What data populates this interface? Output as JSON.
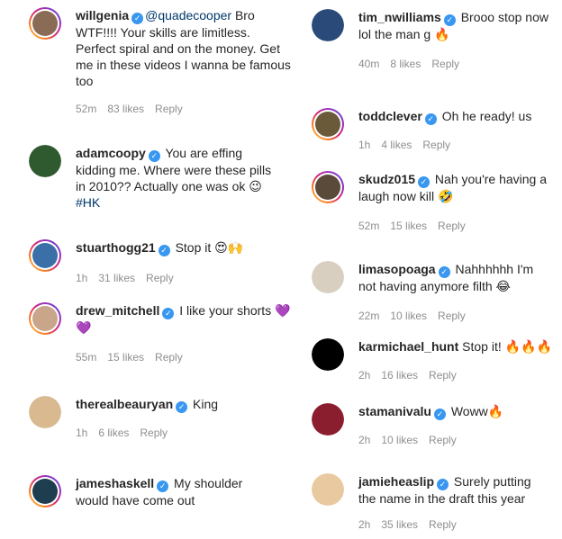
{
  "left": [
    {
      "user": "willgenia",
      "mention": "@quadecooper",
      "text": " Bro WTF!!!! Your skills are limitless. Perfect spiral and on the money. Get me in these videos I wanna be famous too",
      "time": "52m",
      "likes": "83 likes",
      "reply": "Reply",
      "avatar_color": "#8a6b55",
      "ring": true
    },
    {
      "user": "adamcoopy",
      "text": " You are effing kidding me. Where were these pills in 2010?? Actually one was ok 😉 ",
      "hashtag": "#HK",
      "time": "",
      "likes": "",
      "reply": "",
      "avatar_color": "#2f5a2f",
      "ring": false
    },
    {
      "user": "stuarthogg21",
      "text": " Stop it 😍🙌",
      "time": "1h",
      "likes": "31 likes",
      "reply": "Reply",
      "avatar_color": "#3b6fa8",
      "ring": true
    },
    {
      "user": "drew_mitchell",
      "text": " I like your shorts 💜💜",
      "time": "55m",
      "likes": "15 likes",
      "reply": "Reply",
      "avatar_color": "#c9a58a",
      "ring": true
    },
    {
      "user": "therealbeauryan",
      "text": " King",
      "time": "1h",
      "likes": "6 likes",
      "reply": "Reply",
      "avatar_color": "#d9b98f",
      "ring": false
    },
    {
      "user": "jameshaskell",
      "text": " My shoulder would have come out",
      "time": "",
      "likes": "",
      "reply": "",
      "avatar_color": "#1e3d4f",
      "ring": true
    }
  ],
  "right": [
    {
      "user": "tim_nwilliams",
      "text": " Brooo stop now lol the man g 🔥",
      "time": "40m",
      "likes": "8 likes",
      "reply": "Reply",
      "avatar_color": "#2a4a7a",
      "ring": false
    },
    {
      "user": "toddclever",
      "text": " Oh he ready! us",
      "time": "1h",
      "likes": "4 likes",
      "reply": "Reply",
      "avatar_color": "#6a5a3a",
      "ring": true
    },
    {
      "user": "skudz015",
      "text": " Nah you're having a laugh now kill 🤣",
      "time": "52m",
      "likes": "15 likes",
      "reply": "Reply",
      "avatar_color": "#5a4a3a",
      "ring": true
    },
    {
      "user": "limasopoaga",
      "text": " Nahhhhhh I'm not having anymore filth 😂",
      "time": "22m",
      "likes": "10 likes",
      "reply": "Reply",
      "avatar_color": "#d8cfc0",
      "ring": false
    },
    {
      "user": "karmichael_hunt",
      "text": " Stop it! 🔥🔥🔥",
      "time": "2h",
      "likes": "16 likes",
      "reply": "Reply",
      "avatar_color": "#000000",
      "ring": false
    },
    {
      "user": "stamanivalu",
      "text": " Woww🔥",
      "time": "2h",
      "likes": "10 likes",
      "reply": "Reply",
      "avatar_color": "#8a1e2e",
      "ring": false
    },
    {
      "user": "jamieheaslip",
      "text": " Surely putting the name in the draft this year",
      "time": "2h",
      "likes": "35 likes",
      "reply": "Reply",
      "avatar_color": "#e8c9a0",
      "ring": false
    }
  ]
}
